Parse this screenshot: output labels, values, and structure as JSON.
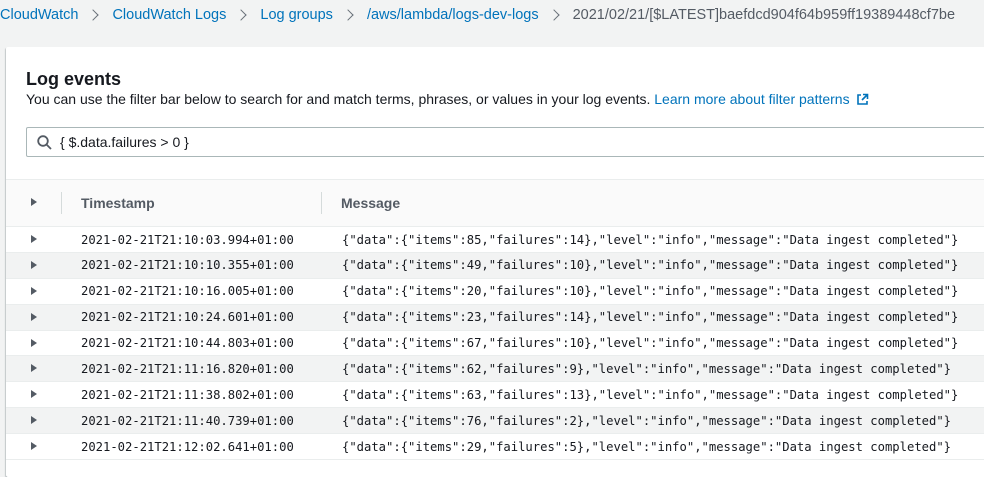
{
  "breadcrumb": [
    {
      "label": "CloudWatch"
    },
    {
      "label": "CloudWatch Logs"
    },
    {
      "label": "Log groups"
    },
    {
      "label": "/aws/lambda/logs-dev-logs"
    },
    {
      "label": "2021/02/21/[$LATEST]baefdcd904f64b959ff19389448cf7be"
    }
  ],
  "panel": {
    "title": "Log events",
    "description": "You can use the filter bar below to search for and match terms, phrases, or values in your log events. ",
    "learn_more": "Learn more about filter patterns"
  },
  "filter": {
    "value": "{ $.data.failures > 0 }",
    "search_icon": "search-icon"
  },
  "table": {
    "columns": [
      "Timestamp",
      "Message"
    ],
    "rows": [
      {
        "timestamp": "2021-02-21T21:10:03.994+01:00",
        "message": "{\"data\":{\"items\":85,\"failures\":14},\"level\":\"info\",\"message\":\"Data ingest completed\"}"
      },
      {
        "timestamp": "2021-02-21T21:10:10.355+01:00",
        "message": "{\"data\":{\"items\":49,\"failures\":10},\"level\":\"info\",\"message\":\"Data ingest completed\"}"
      },
      {
        "timestamp": "2021-02-21T21:10:16.005+01:00",
        "message": "{\"data\":{\"items\":20,\"failures\":10},\"level\":\"info\",\"message\":\"Data ingest completed\"}"
      },
      {
        "timestamp": "2021-02-21T21:10:24.601+01:00",
        "message": "{\"data\":{\"items\":23,\"failures\":14},\"level\":\"info\",\"message\":\"Data ingest completed\"}"
      },
      {
        "timestamp": "2021-02-21T21:10:44.803+01:00",
        "message": "{\"data\":{\"items\":67,\"failures\":10},\"level\":\"info\",\"message\":\"Data ingest completed\"}"
      },
      {
        "timestamp": "2021-02-21T21:11:16.820+01:00",
        "message": "{\"data\":{\"items\":62,\"failures\":9},\"level\":\"info\",\"message\":\"Data ingest completed\"}"
      },
      {
        "timestamp": "2021-02-21T21:11:38.802+01:00",
        "message": "{\"data\":{\"items\":63,\"failures\":13},\"level\":\"info\",\"message\":\"Data ingest completed\"}"
      },
      {
        "timestamp": "2021-02-21T21:11:40.739+01:00",
        "message": "{\"data\":{\"items\":76,\"failures\":2},\"level\":\"info\",\"message\":\"Data ingest completed\"}"
      },
      {
        "timestamp": "2021-02-21T21:12:02.641+01:00",
        "message": "{\"data\":{\"items\":29,\"failures\":5},\"level\":\"info\",\"message\":\"Data ingest completed\"}"
      }
    ]
  },
  "colors": {
    "link": "#0073bb",
    "background": "#f2f3f3",
    "panel": "#ffffff",
    "alt_row": "#f2f3f3"
  }
}
